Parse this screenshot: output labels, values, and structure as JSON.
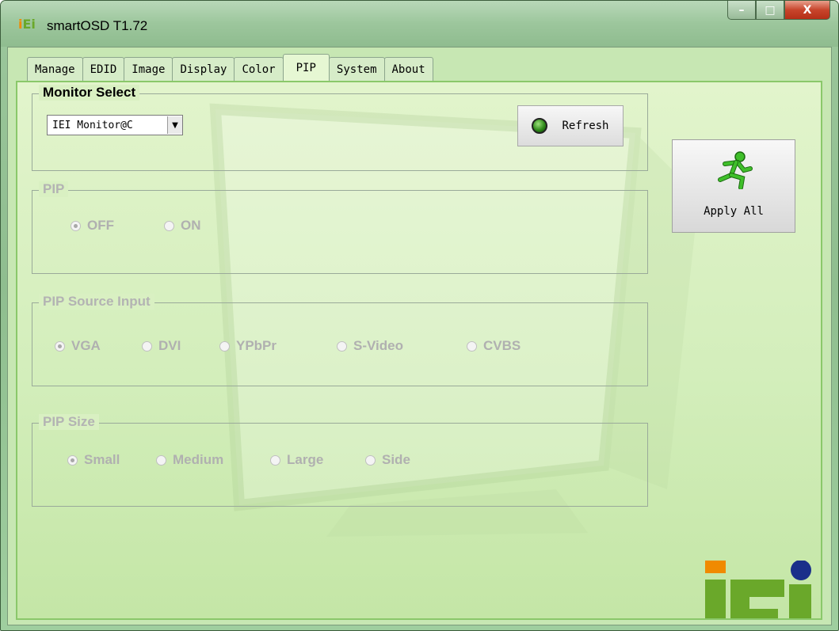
{
  "window": {
    "title": "smartOSD T1.72",
    "app_icon_text": "iEi",
    "controls": {
      "minimize": "–",
      "maximize": "□",
      "close": "X"
    }
  },
  "tabs": [
    {
      "label": "Manage"
    },
    {
      "label": "EDID"
    },
    {
      "label": "Image"
    },
    {
      "label": "Display"
    },
    {
      "label": "Color"
    },
    {
      "label": "PIP",
      "active": true
    },
    {
      "label": "System"
    },
    {
      "label": "About"
    }
  ],
  "monitor_select": {
    "legend": "Monitor Select",
    "selected": "IEI Monitor@C",
    "refresh_label": "Refresh"
  },
  "apply_all": {
    "label": "Apply All",
    "icon": "running-man-icon"
  },
  "pip": {
    "legend": "PIP",
    "options": [
      "OFF",
      "ON"
    ],
    "selected": "OFF"
  },
  "pip_source": {
    "legend": "PIP Source Input",
    "options": [
      "VGA",
      "DVI",
      "YPbPr",
      "S-Video",
      "CVBS"
    ],
    "selected": "VGA"
  },
  "pip_size": {
    "legend": "PIP Size",
    "options": [
      "Small",
      "Medium",
      "Large",
      "Side"
    ],
    "selected": "Small"
  },
  "logo": {
    "text": "iEi",
    "mark": "®"
  },
  "colors": {
    "accent_green": "#6aa82a",
    "accent_orange": "#f08a00",
    "accent_blue": "#1a2f8a",
    "disabled_text": "#b0b0b0"
  }
}
